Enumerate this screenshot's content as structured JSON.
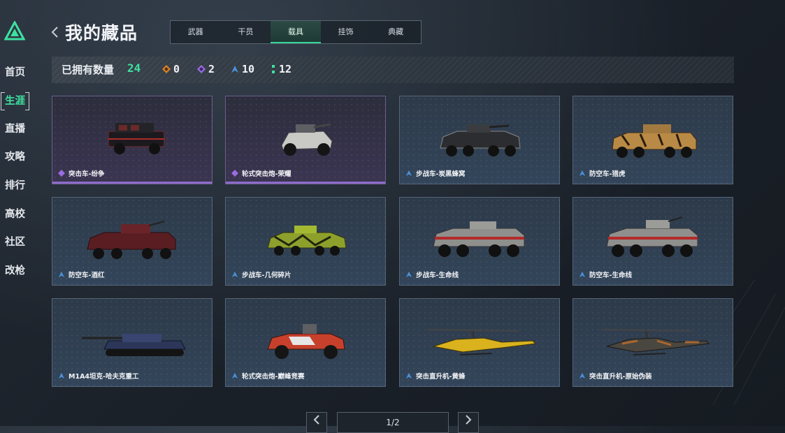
{
  "nav": {
    "items": [
      {
        "label": "首页",
        "active": false
      },
      {
        "label": "生涯",
        "active": true
      },
      {
        "label": "直播",
        "active": false
      },
      {
        "label": "攻略",
        "active": false
      },
      {
        "label": "排行",
        "active": false
      },
      {
        "label": "高校",
        "active": false
      },
      {
        "label": "社区",
        "active": false
      },
      {
        "label": "改枪",
        "active": false
      }
    ]
  },
  "header": {
    "title": "我的藏品",
    "tabs": [
      {
        "label": "武器",
        "active": false
      },
      {
        "label": "干员",
        "active": false
      },
      {
        "label": "载具",
        "active": true
      },
      {
        "label": "挂饰",
        "active": false
      },
      {
        "label": "典藏",
        "active": false
      }
    ]
  },
  "stats": {
    "label": "已拥有数量",
    "total": "24",
    "rarities": [
      {
        "icon": "orange-diamond-icon",
        "color": "#d9822b",
        "count": "0"
      },
      {
        "icon": "purple-diamond-icon",
        "color": "#9a6de0",
        "count": "2"
      },
      {
        "icon": "blue-chevron-icon",
        "color": "#4a90d9",
        "count": "10"
      },
      {
        "icon": "green-dots-icon",
        "color": "#3fe0a0",
        "count": "12"
      }
    ]
  },
  "cards": [
    {
      "name": "突击车-纷争",
      "rarity": "purple",
      "vehicle": "armored-truck-icon"
    },
    {
      "name": "轮式突击炮-荣耀",
      "rarity": "purple",
      "vehicle": "assault-buggy-icon"
    },
    {
      "name": "步战车-炭黑蜂窝",
      "rarity": "blue",
      "vehicle": "ifv-icon"
    },
    {
      "name": "防空车-猎虎",
      "rarity": "blue",
      "vehicle": "aa-vehicle-icon"
    },
    {
      "name": "防空车-酒红",
      "rarity": "blue",
      "vehicle": "aa-vehicle-icon"
    },
    {
      "name": "步战车-几何碎片",
      "rarity": "blue",
      "vehicle": "ifv-icon"
    },
    {
      "name": "步战车-生命线",
      "rarity": "blue",
      "vehicle": "ifv-icon"
    },
    {
      "name": "防空车-生命线",
      "rarity": "blue",
      "vehicle": "aa-vehicle-icon"
    },
    {
      "name": "M1A4坦克-哈夫克重工",
      "rarity": "blue",
      "vehicle": "tank-icon"
    },
    {
      "name": "轮式突击炮-巅峰竞赛",
      "rarity": "blue",
      "vehicle": "assault-buggy-icon"
    },
    {
      "name": "突击直升机-黄蜂",
      "rarity": "blue",
      "vehicle": "helicopter-icon"
    },
    {
      "name": "突击直升机-原始伪装",
      "rarity": "blue",
      "vehicle": "helicopter-icon"
    }
  ],
  "pager": {
    "text": "1/2"
  },
  "colors": {
    "accent": "#3fe0a0",
    "purple": "#9a6de0",
    "blue": "#4a90d9"
  }
}
